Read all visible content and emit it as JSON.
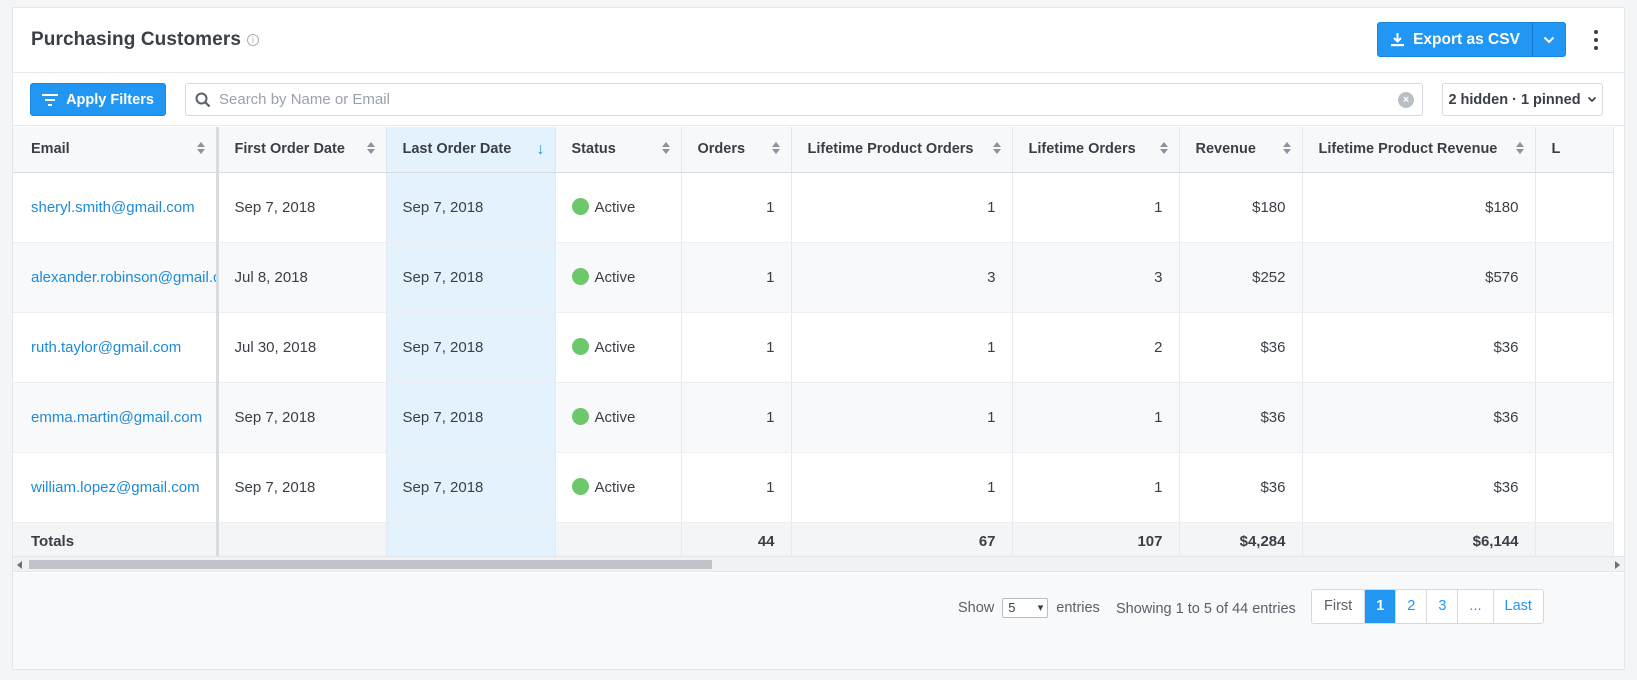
{
  "header": {
    "title": "Purchasing Customers",
    "info_glyph": "i",
    "export_label": "Export as CSV"
  },
  "toolbar": {
    "apply_filters_label": "Apply Filters",
    "search_placeholder": "Search by Name or Email",
    "columns_label": "2 hidden · 1 pinned"
  },
  "table": {
    "columns": [
      "Email",
      "First Order Date",
      "Last Order Date",
      "Status",
      "Orders",
      "Lifetime Product Orders",
      "Lifetime Orders",
      "Revenue",
      "Lifetime Product Revenue",
      "L"
    ],
    "rows": [
      [
        "sheryl.smith@gmail.com",
        "Sep 7, 2018",
        "Sep 7, 2018",
        "Active",
        "1",
        "1",
        "1",
        "$180",
        "$180",
        ""
      ],
      [
        "alexander.robinson@gmail.com",
        "Jul 8, 2018",
        "Sep 7, 2018",
        "Active",
        "1",
        "3",
        "3",
        "$252",
        "$576",
        ""
      ],
      [
        "ruth.taylor@gmail.com",
        "Jul 30, 2018",
        "Sep 7, 2018",
        "Active",
        "1",
        "1",
        "2",
        "$36",
        "$36",
        ""
      ],
      [
        "emma.martin@gmail.com",
        "Sep 7, 2018",
        "Sep 7, 2018",
        "Active",
        "1",
        "1",
        "1",
        "$36",
        "$36",
        ""
      ],
      [
        "william.lopez@gmail.com",
        "Sep 7, 2018",
        "Sep 7, 2018",
        "Active",
        "1",
        "1",
        "1",
        "$36",
        "$36",
        ""
      ]
    ],
    "totals": [
      "Totals",
      "",
      "",
      "",
      "44",
      "67",
      "107",
      "$4,284",
      "$6,144",
      ""
    ],
    "status_color": "#6cc86a",
    "sorted_column": "Last Order Date"
  },
  "footer": {
    "show_label": "Show",
    "entries_value": "5",
    "entries_label": "entries",
    "showing_text": "Showing 1 to 5 of 44 entries",
    "pager": [
      "First",
      "1",
      "2",
      "3",
      "...",
      "Last"
    ],
    "current_page": "1"
  },
  "colors": {
    "accent": "#2196f3",
    "link": "#1d8bd6",
    "sorted_column_bg": "#e4f2fd"
  }
}
